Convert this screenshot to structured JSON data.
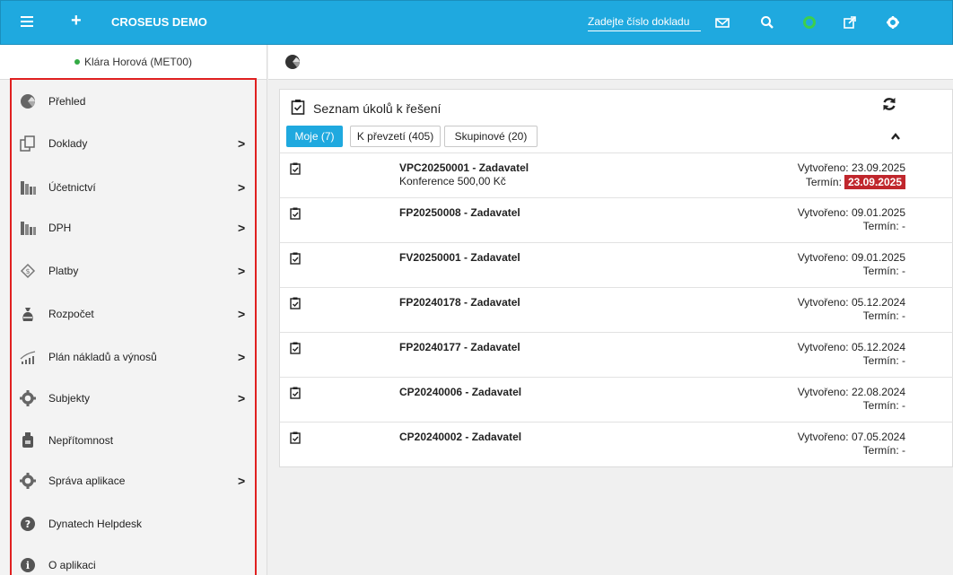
{
  "topbar": {
    "brand": "CROSEUS DEMO",
    "doc_search_placeholder": "Zadejte číslo dokladu"
  },
  "sidebar": {
    "user": "Klára Horová (MET00)",
    "items": [
      {
        "label": "Přehled",
        "icon": "dashboard-icon",
        "has_children": false
      },
      {
        "label": "Doklady",
        "icon": "documents-icon",
        "has_children": true
      },
      {
        "label": "Účetnictví",
        "icon": "accounting-icon",
        "has_children": true
      },
      {
        "label": "DPH",
        "icon": "vat-icon",
        "has_children": true
      },
      {
        "label": "Platby",
        "icon": "payments-icon",
        "has_children": true
      },
      {
        "label": "Rozpočet",
        "icon": "budget-icon",
        "has_children": true
      },
      {
        "label": "Plán nákladů a výnosů",
        "icon": "plan-chart-icon",
        "has_children": true
      },
      {
        "label": "Subjekty",
        "icon": "gear-icon",
        "has_children": true
      },
      {
        "label": "Nepřítomnost",
        "icon": "absence-icon",
        "has_children": false
      },
      {
        "label": "Správa aplikace",
        "icon": "gear-icon",
        "has_children": true
      },
      {
        "label": "Dynatech Helpdesk",
        "icon": "help-icon",
        "has_children": false
      },
      {
        "label": "O aplikaci",
        "icon": "info-icon",
        "has_children": false
      }
    ]
  },
  "panel": {
    "title": "Seznam úkolů k řešení",
    "tabs": [
      {
        "label": "Moje (7)",
        "active": true
      },
      {
        "label": "K převzetí (405)",
        "active": false
      },
      {
        "label": "Skupinové (20)",
        "active": false
      }
    ],
    "tasks": [
      {
        "name": "VPC20250001 - Zadavatel",
        "sub": "Konference 500,00 Kč",
        "created": "Vytvořeno: 23.09.2025",
        "deadline_label": "Termín:",
        "deadline": "23.09.2025",
        "overdue": true
      },
      {
        "name": "FP20250008 - Zadavatel",
        "sub": "",
        "created": "Vytvořeno: 09.01.2025",
        "deadline_label": "Termín:",
        "deadline": "-",
        "overdue": false
      },
      {
        "name": "FV20250001 - Zadavatel",
        "sub": "",
        "created": "Vytvořeno: 09.01.2025",
        "deadline_label": "Termín:",
        "deadline": "-",
        "overdue": false
      },
      {
        "name": "FP20240178 - Zadavatel",
        "sub": "",
        "created": "Vytvořeno: 05.12.2024",
        "deadline_label": "Termín:",
        "deadline": "-",
        "overdue": false
      },
      {
        "name": "FP20240177 - Zadavatel",
        "sub": "",
        "created": "Vytvořeno: 05.12.2024",
        "deadline_label": "Termín:",
        "deadline": "-",
        "overdue": false
      },
      {
        "name": "CP20240006 - Zadavatel",
        "sub": "",
        "created": "Vytvořeno: 22.08.2024",
        "deadline_label": "Termín:",
        "deadline": "-",
        "overdue": false
      },
      {
        "name": "CP20240002 - Zadavatel",
        "sub": "",
        "created": "Vytvořeno: 07.05.2024",
        "deadline_label": "Termín:",
        "deadline": "-",
        "overdue": false
      }
    ]
  },
  "colors": {
    "accent": "#1fa9df",
    "overdue": "#c0272d",
    "highlight_frame": "#e02020",
    "online": "#33aa44"
  }
}
